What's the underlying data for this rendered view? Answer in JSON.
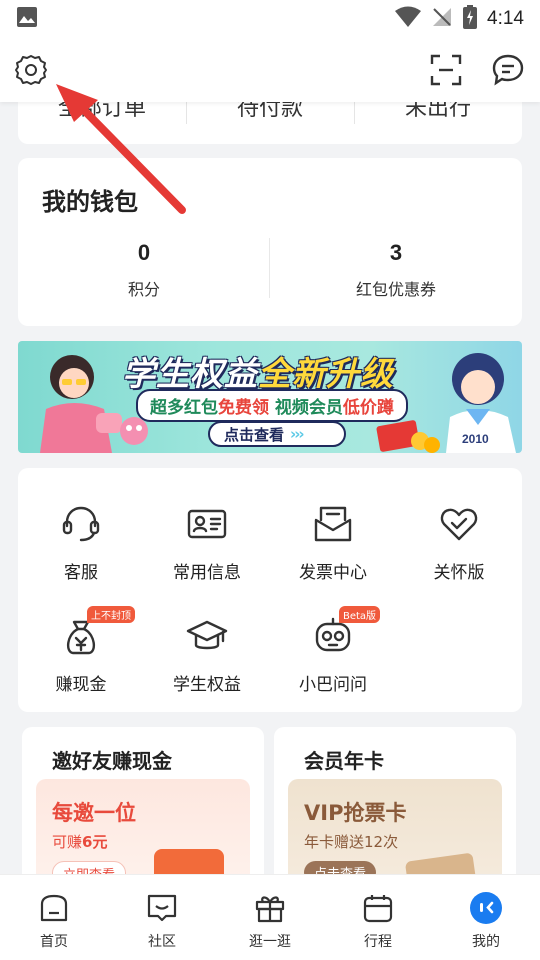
{
  "status_bar": {
    "time": "4:14"
  },
  "orders": {
    "items": [
      "全部订单",
      "待付款",
      "未出行"
    ]
  },
  "wallet": {
    "title": "我的钱包",
    "points": {
      "value": "0",
      "label": "积分"
    },
    "coupons": {
      "value": "3",
      "label": "红包优惠券"
    }
  },
  "banner": {
    "title_a": "学生权益",
    "title_b": "全新升级",
    "sub_a": "超多红包",
    "sub_b": "免费领",
    "sub_c": "视频会员",
    "sub_d": "低价蹲",
    "button": "点击查看",
    "arrows": "›››",
    "badge_text": "2010"
  },
  "services": [
    {
      "label": "客服",
      "icon": "headset-icon"
    },
    {
      "label": "常用信息",
      "icon": "id-card-icon"
    },
    {
      "label": "发票中心",
      "icon": "invoice-icon"
    },
    {
      "label": "关怀版",
      "icon": "heart-check-icon"
    },
    {
      "label": "赚现金",
      "icon": "money-bag-icon",
      "badge": "上不封顶"
    },
    {
      "label": "学生权益",
      "icon": "graduation-cap-icon"
    },
    {
      "label": "小巴问问",
      "icon": "robot-icon",
      "badge": "Beta版"
    }
  ],
  "promos": [
    {
      "title": "邀好友赚现金",
      "big": "每邀一位",
      "small_a": "可赚",
      "small_b": "6元",
      "button": "立即查看",
      "accent": "#e84a3c"
    },
    {
      "title": "会员年卡",
      "big": "VIP抢票卡",
      "small": "年卡赠送12次",
      "button": "点击查看",
      "accent": "#8a5a3a"
    }
  ],
  "tabs": [
    {
      "label": "首页",
      "icon": "home-icon"
    },
    {
      "label": "社区",
      "icon": "community-icon"
    },
    {
      "label": "逛一逛",
      "icon": "gift-icon"
    },
    {
      "label": "行程",
      "icon": "calendar-icon"
    },
    {
      "label": "我的",
      "icon": "profile-icon",
      "active": true
    }
  ],
  "colors": {
    "accent": "#1a7cf0",
    "badge": "#f05a3c",
    "arrow": "#e53935"
  }
}
